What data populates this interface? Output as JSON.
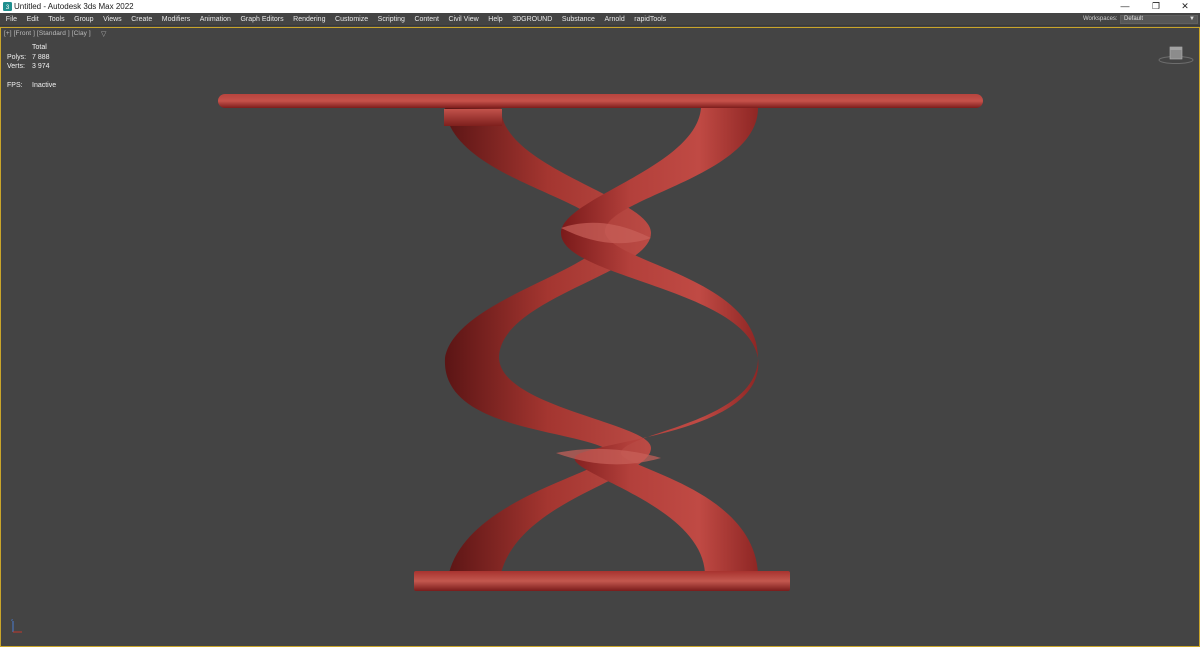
{
  "titlebar": {
    "title": "Untitled - Autodesk 3ds Max 2022",
    "minimize": "—",
    "restore": "❐",
    "close": "✕"
  },
  "menu": {
    "items": [
      "File",
      "Edit",
      "Tools",
      "Group",
      "Views",
      "Create",
      "Modifiers",
      "Animation",
      "Graph Editors",
      "Rendering",
      "Customize",
      "Scripting",
      "Content",
      "Civil View",
      "Help",
      "3DGROUND",
      "Substance",
      "Arnold",
      "rapidTools"
    ],
    "workspaces_label": "Workspaces:",
    "workspace_value": "Default"
  },
  "viewport": {
    "label": "[+] [Front ] [Standard ] [Clay ]",
    "stats": {
      "header": "Total",
      "polys_label": "Polys:",
      "polys_value": "7 888",
      "verts_label": "Verts:",
      "verts_value": "3 974",
      "fps_label": "FPS:",
      "fps_value": "Inactive"
    }
  },
  "icons": {
    "app": "3dsmax-app-icon",
    "filter": "viewport-filter-icon",
    "viewcube": "viewcube-icon",
    "axis": "axis-tripod-icon"
  },
  "colors": {
    "viewport_bg": "#444444",
    "active_border": "#c9a52a",
    "object": "#b53a36"
  }
}
